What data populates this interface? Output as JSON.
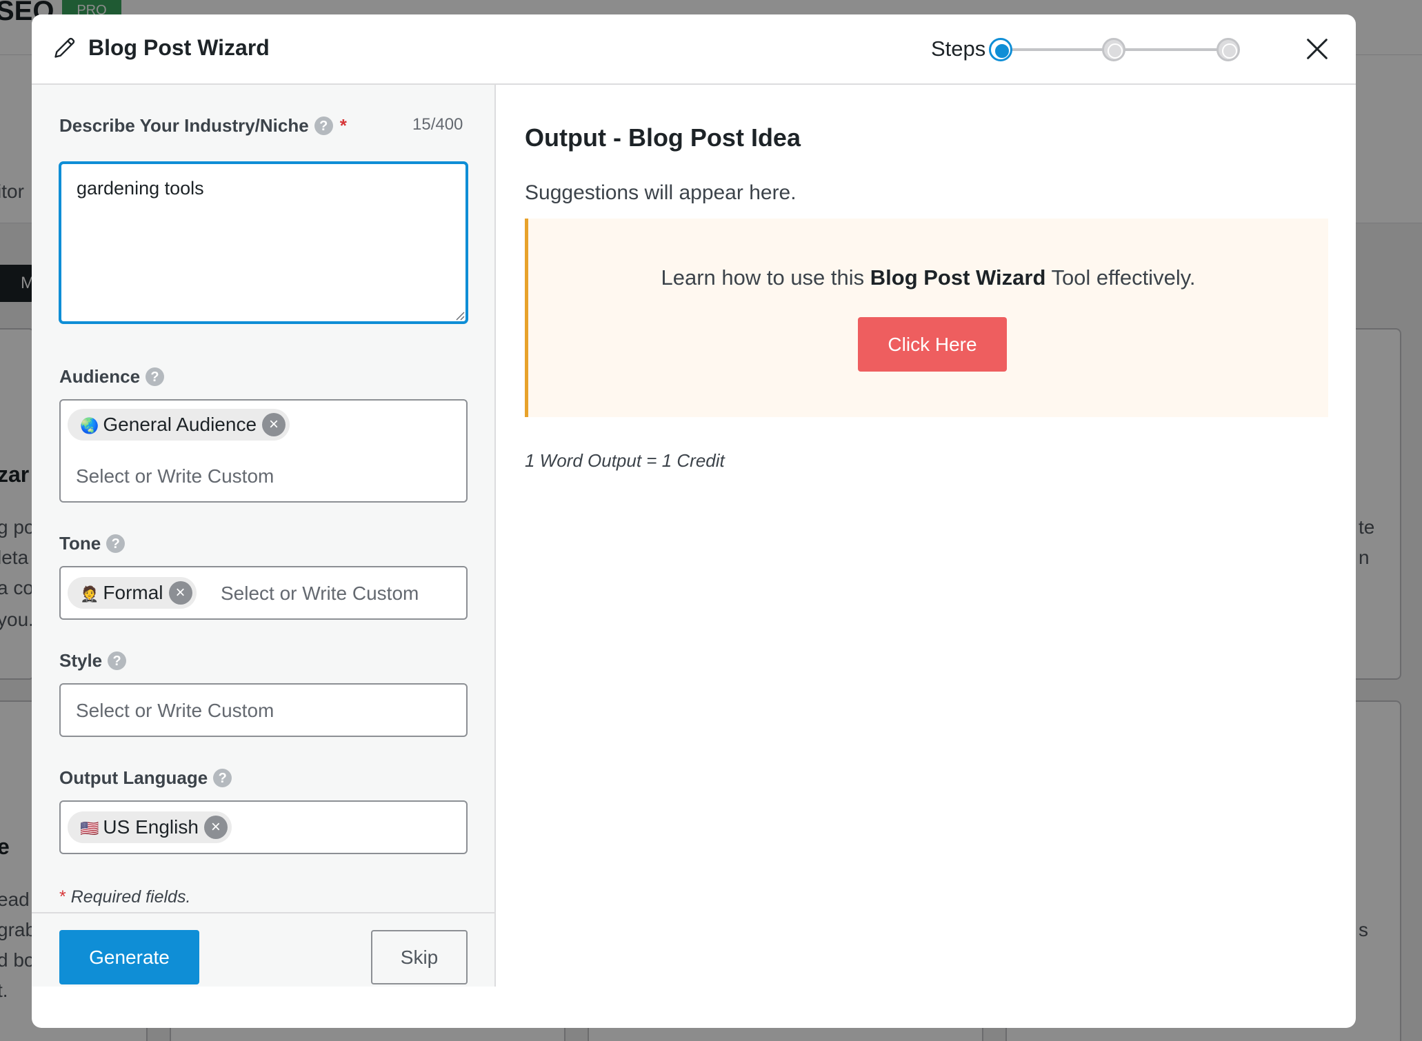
{
  "background": {
    "brand": "SEO",
    "badge": "PRO",
    "tab_fragment": "itor",
    "pill_fragment": "M",
    "card_heading_fragment": "zar",
    "card_lines": [
      "g po",
      "leta",
      "a co",
      "you."
    ],
    "card2_heading_fragment": "e",
    "card2_lines": [
      "ead",
      "grab",
      "d bo",
      "t."
    ],
    "right_fragments": [
      "te",
      "n"
    ],
    "right_fragment_lower": "s"
  },
  "modal": {
    "title": "Blog Post Wizard",
    "steps_label": "Steps",
    "steps": [
      {
        "state": "active"
      },
      {
        "state": "inactive"
      },
      {
        "state": "inactive"
      }
    ],
    "close_icon": "close-icon"
  },
  "form": {
    "niche": {
      "label": "Describe Your Industry/Niche",
      "required_mark": "*",
      "char_count": "15/400",
      "value": "gardening tools"
    },
    "audience": {
      "label": "Audience",
      "chip_emoji": "🌏",
      "chip_label": "General Audience",
      "placeholder": "Select or Write Custom"
    },
    "tone": {
      "label": "Tone",
      "chip_emoji": "🤵",
      "chip_label": "Formal",
      "placeholder": "Select or Write Custom"
    },
    "style": {
      "label": "Style",
      "placeholder": "Select or Write Custom"
    },
    "language": {
      "label": "Output Language",
      "chip_emoji": "🇺🇸",
      "chip_label": "US English"
    },
    "required_star": "*",
    "required_note": "Required fields.",
    "generate_label": "Generate",
    "skip_label": "Skip"
  },
  "output": {
    "title": "Output - Blog Post Idea",
    "subtitle": "Suggestions will appear here.",
    "info_prefix": "Learn how to use this ",
    "info_bold": "Blog Post Wizard",
    "info_suffix": " Tool effectively.",
    "click_label": "Click Here",
    "credit_note": "1 Word Output = 1 Credit"
  },
  "colors": {
    "primary": "#0f8ed6",
    "danger_button": "#ee5e5f",
    "info_border": "#e8a22b",
    "info_bg": "#fff8f0",
    "required": "#d63638"
  }
}
